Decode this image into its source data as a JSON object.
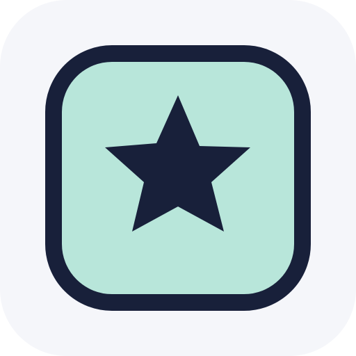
{
  "icon": {
    "name": "star-icon",
    "colors": {
      "background": "#F5F6FA",
      "tile_fill": "#B8E6DA",
      "outline": "#18203A",
      "star": "#18203A"
    }
  }
}
